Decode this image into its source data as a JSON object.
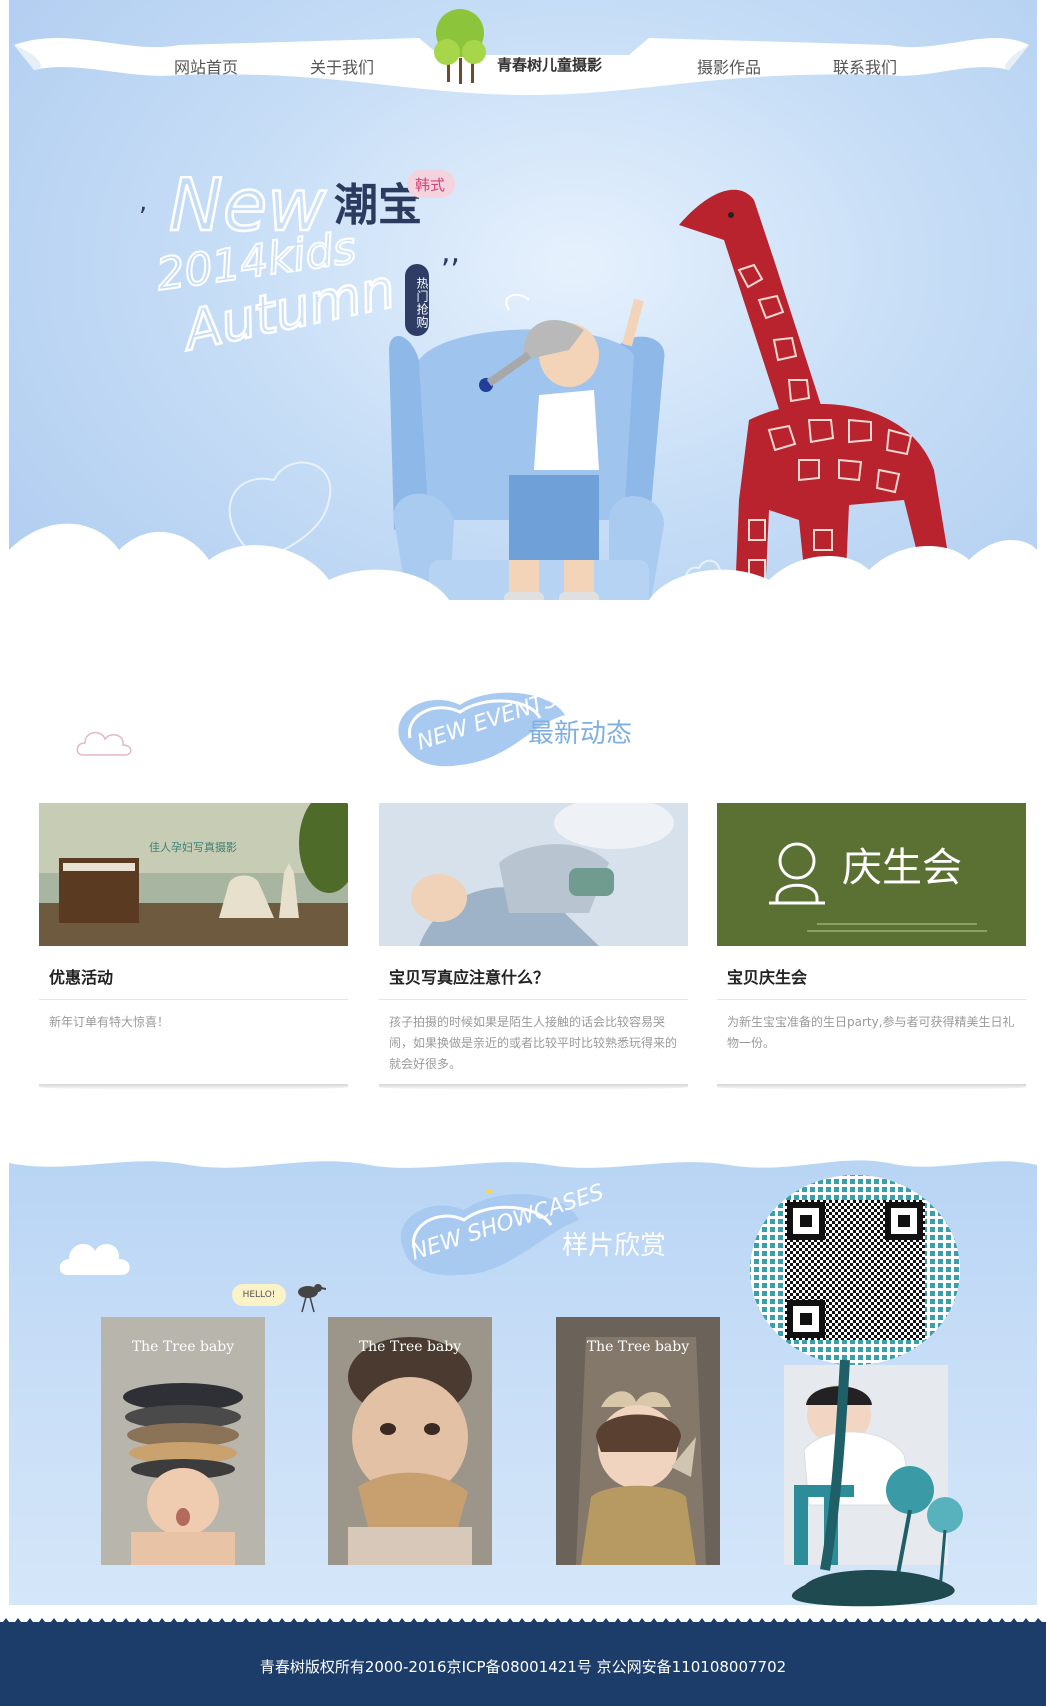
{
  "nav": {
    "items": [
      "网站首页",
      "关于我们",
      "摄影作品",
      "联系我们"
    ],
    "brand": "青春树儿童摄影"
  },
  "hero": {
    "script_en_1": "New",
    "script_en_2": "2014kids",
    "script_en_3": "Autumn",
    "headline_cn": "潮宝",
    "tag": "韩式",
    "vertical": "热门抢购"
  },
  "events": {
    "badge": "NEW EVENTS",
    "heading": "最新动态",
    "cards": [
      {
        "title": "优惠活动",
        "desc": "新年订单有特大惊喜！",
        "img_label": "佳人孕妇写真摄影"
      },
      {
        "title": "宝贝写真应注意什么？",
        "desc": "孩子拍摄的时候如果是陌生人接触的话会比较容易哭闹，如果换做是亲近的或者比较平时比较熟悉玩得来的就会好很多。",
        "img_label": ""
      },
      {
        "title": "宝贝庆生会",
        "desc": "为新生宝宝准备的生日party,参与者可获得精美生日礼物一份。",
        "img_label": "庆生会"
      }
    ]
  },
  "showcase": {
    "badge": "NEW SHOWCASES",
    "heading": "样片欣赏",
    "hello": "HELLO!",
    "brand_on_photo": "The Tree baby"
  },
  "footer": {
    "text": "青春树版权所有2000-2016京ICP备08001421号  京公网安备110108007702"
  },
  "colors": {
    "sky": "#abc9ef",
    "footer": "#1c3c6a",
    "heading_blue": "#7fb0e0",
    "giraffe": "#b8232e",
    "party_green": "#5b7133"
  }
}
